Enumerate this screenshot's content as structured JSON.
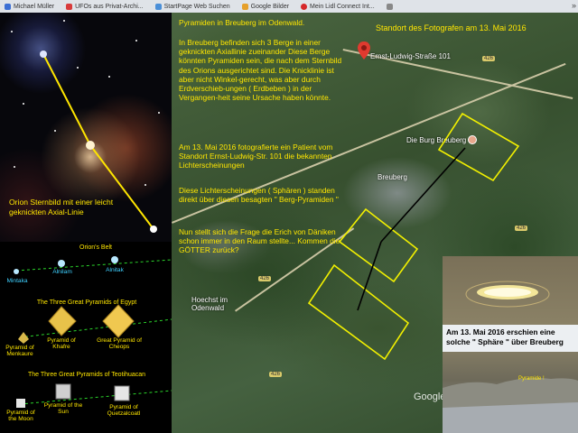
{
  "browser": {
    "tabs": [
      {
        "label": "Michael Müller",
        "color": "#3b6fd4"
      },
      {
        "label": "UFOs aus Privat-Archi...",
        "color": "#d83b3b"
      },
      {
        "label": "StartPage Web Suchen",
        "color": "#4a8fd8"
      },
      {
        "label": "Google Bilder",
        "color": "#e6a02b"
      },
      {
        "label": "Mein Lidl Connect Int...",
        "color": "#d6282a"
      },
      {
        "label": "",
        "color": "#888888"
      }
    ],
    "menu_icon": "»"
  },
  "star_panel": {
    "caption": "Orion Sternbild mit einer leicht geknickten Axial-Linie"
  },
  "diagram": {
    "belt_title": "Orion's Belt",
    "stars": [
      "Mintaka",
      "Alnilam",
      "Alnitak"
    ],
    "egypt_title": "The Three Great Pyramids of Egypt",
    "egypt_pyramids": [
      "Pyramid of Menkaure",
      "Pyramid of Khafre",
      "Great Pyramid of Cheops"
    ],
    "teo_title": "The Three Great Pyramids of Teotihuacan",
    "teo_pyramids": [
      "Pyramid of the Moon",
      "Pyramid of the Sun",
      "Pyramid of Quetzalcoatl"
    ]
  },
  "map": {
    "title": "Pyramiden in Breuberg im Odenwald.",
    "paragraph1": "In Breuberg befinden sich 3 Berge in einer geknickten Axiallinie zueinander Diese Berge könnten Pyramiden sein, die nach dem Sternbild des Orions ausgerichtet sind. Die Knicklinie ist aber nicht Winkel-gerecht, was aber durch Erdverschieb-ungen ( Erdbeben ) in der Vergangen-heit seine Ursache haben könnte.",
    "paragraph2": "Am 13. Mai 2016 fotografierte ein Patient vom Standort Ernst-Ludwig-Str. 101 die bekannten Lichterscheinungen",
    "paragraph3": "Diese Lichterscheinungen ( Sphären ) standen direkt über diesen besagten \" Berg-Pyramiden \"",
    "paragraph4": "Nun stellt sich die Frage die Erich von Däniken schon immer in den Raum stellte... Kommen die GÖTTER zurück?",
    "photographer_label": "Standort des Fotografen am 13. Mai 2016",
    "street": "Ernst-Ludwig-Straße 101",
    "castle": "Die Burg Breuberg",
    "town1": "Breuberg",
    "town2": "Hoechst im Odenwald",
    "road_numbers": [
      "426",
      "426",
      "426",
      "426"
    ],
    "google": "Google"
  },
  "photo": {
    "caption": "Am 13. Mai 2016 erschien eine solche \" Sphäre \" über Breuberg",
    "pyramid_label": "Pyramide !"
  },
  "colors": {
    "caption_yellow": "#ffe600",
    "pin_red": "#e03a2f",
    "box_yellow": "#f2f000"
  }
}
